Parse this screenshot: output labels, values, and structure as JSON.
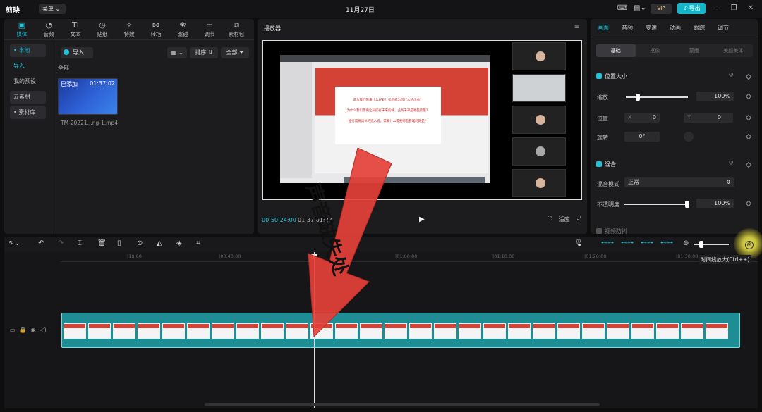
{
  "app": {
    "logo": "剪映",
    "menu": "菜单",
    "date": "11月27日",
    "vip": "VIP",
    "export": "导出"
  },
  "media": {
    "tabs": [
      {
        "label": "媒体",
        "icon": "▣"
      },
      {
        "label": "音频",
        "icon": "◔"
      },
      {
        "label": "文本",
        "icon": "TI"
      },
      {
        "label": "贴纸",
        "icon": "◷"
      },
      {
        "label": "特效",
        "icon": "✧"
      },
      {
        "label": "转场",
        "icon": "⋈"
      },
      {
        "label": "滤镜",
        "icon": "❀"
      },
      {
        "label": "调节",
        "icon": "⚌"
      },
      {
        "label": "素材包",
        "icon": "⧉"
      }
    ],
    "side": [
      "• 本地",
      "导入",
      "我的预设",
      "云素材",
      "• 素材库"
    ],
    "import": "导入",
    "sort": "排序",
    "filter": "全部",
    "all": "全部",
    "thumb_added": "已添加",
    "thumb_duration": "01:37:02",
    "thumb_name": "TM-20221...ng-1.mp4"
  },
  "player": {
    "title": "播放器",
    "current": "00:50:24:00",
    "total": "01:37:01:27",
    "ratio": "适应",
    "slide_lines": [
      "说为我们带来什么好处？如何成为首代人的优秀？",
      "为什么我们需要让同们有未来的格，业务未来是哪些能量？",
      "推行需要具体的选人者，需要什么需要哪些管理的跟是？"
    ]
  },
  "props": {
    "tabs": [
      "画面",
      "音频",
      "变速",
      "动画",
      "跟踪",
      "调节"
    ],
    "subtabs": [
      "基础",
      "抠像",
      "蒙版",
      "美颜美体"
    ],
    "pos_section": "位置大小",
    "scale_label": "缩放",
    "scale_value": "100%",
    "position_label": "位置",
    "x_label": "X",
    "x_value": "0",
    "y_label": "Y",
    "y_value": "0",
    "rotate_label": "旋转",
    "rotate_value": "0°",
    "blend_section": "混合",
    "blend_mode_label": "混合模式",
    "blend_mode_value": "正常",
    "opacity_label": "不透明度",
    "opacity_value": "100%",
    "next_section": "视频防抖"
  },
  "timeline": {
    "ticks": [
      "|10:00",
      "|00:40:00",
      "|01:00:00",
      "|01:10:00",
      "|01:20:00",
      "|01:30:00"
    ],
    "zoom_tip": "时间线放大(Ctrl++)"
  },
  "annotation": {
    "text": "声音缺失处"
  }
}
